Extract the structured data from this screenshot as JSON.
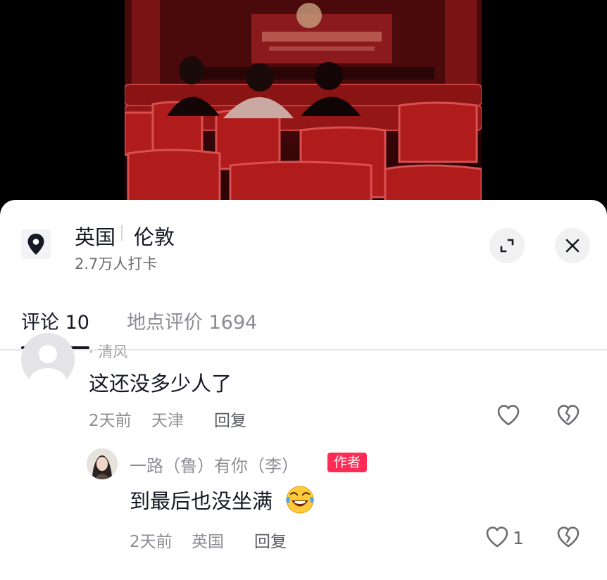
{
  "location": {
    "country": "英国",
    "city": "伦敦",
    "checkins": "2.7万人打卡",
    "pin_icon": "location-pin-icon",
    "expand_icon": "expand-icon",
    "close_icon": "close-icon"
  },
  "tabs": [
    {
      "label": "评论 10",
      "active": true
    },
    {
      "label": "地点评价 1694",
      "active": false
    }
  ],
  "comments": [
    {
      "username": "· 清风",
      "text": "这还没多少人了",
      "time": "2天前",
      "region": "天津",
      "reply_label": "回复",
      "like_icon": "heart-outline-icon",
      "dislike_icon": "broken-heart-icon"
    },
    {
      "username": "一路（鲁）有你（李）",
      "badge": "作者",
      "text": "到最后也没坐满",
      "emoji": "laughing-crying-emoji",
      "time": "2天前",
      "region": "英国",
      "reply_label": "回复",
      "like_count": "1",
      "like_icon": "heart-outline-icon",
      "dislike_icon": "broken-heart-icon"
    }
  ],
  "colors": {
    "text_primary": "#161823",
    "text_secondary": "#8e8f95",
    "badge_bg": "#fe2c55",
    "sheet_bg": "#ffffff"
  }
}
